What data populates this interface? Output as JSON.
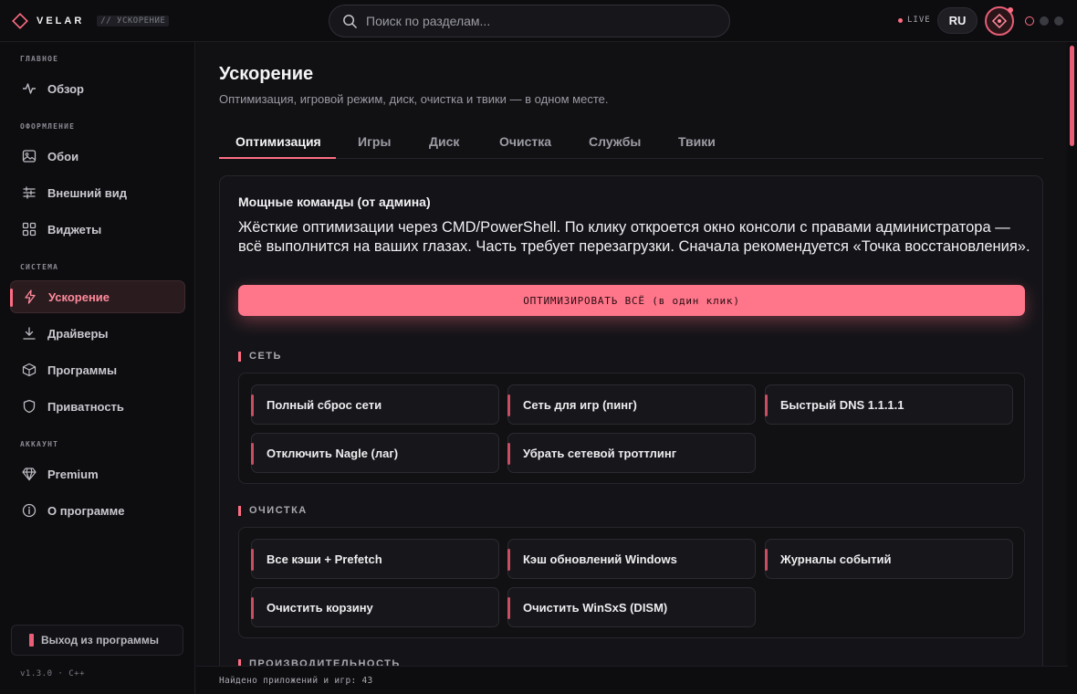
{
  "brand": {
    "name": "VELAR",
    "crumb": "// УСКОРЕНИЕ"
  },
  "search": {
    "placeholder": "Поиск по разделам..."
  },
  "header": {
    "live": "LIVE",
    "lang": "RU"
  },
  "colors": {
    "accent": "#ff6d84",
    "background": "#111114",
    "sidebar": "#0d0d10"
  },
  "sidebar": {
    "sections": [
      {
        "title": "ГЛАВНОЕ",
        "items": [
          {
            "label": "Обзор",
            "icon": "activity-icon"
          }
        ]
      },
      {
        "title": "ОФОРМЛЕНИЕ",
        "items": [
          {
            "label": "Обои",
            "icon": "image-icon"
          },
          {
            "label": "Внешний вид",
            "icon": "sliders-icon"
          },
          {
            "label": "Виджеты",
            "icon": "grid-icon"
          }
        ]
      },
      {
        "title": "СИСТЕМА",
        "items": [
          {
            "label": "Ускорение",
            "icon": "lightning-icon",
            "active": true
          },
          {
            "label": "Драйверы",
            "icon": "download-icon"
          },
          {
            "label": "Программы",
            "icon": "box-icon"
          },
          {
            "label": "Приватность",
            "icon": "shield-icon"
          }
        ]
      },
      {
        "title": "АККАУНТ",
        "items": [
          {
            "label": "Premium",
            "icon": "diamond-icon"
          },
          {
            "label": "О программе",
            "icon": "info-icon"
          }
        ]
      }
    ],
    "exit_label": "Выход из программы",
    "version": "v1.3.0 · C++"
  },
  "page": {
    "title": "Ускорение",
    "subtitle": "Оптимизация, игровой режим, диск, очистка и твики — в одном месте.",
    "tabs": [
      "Оптимизация",
      "Игры",
      "Диск",
      "Очистка",
      "Службы",
      "Твики"
    ],
    "active_tab": "Оптимизация"
  },
  "panel": {
    "title": "Мощные команды (от админа)",
    "description": "Жёсткие оптимизации через CMD/PowerShell. По клику откроется окно консоли с правами администратора — всё выполнится на ваших глазах. Часть требует перезагрузки. Сначала рекомендуется «Точка восстановления».",
    "optimize_all_label": "ОПТИМИЗИРОВАТЬ ВСЁ (в один клик)",
    "groups": [
      {
        "label": "СЕТЬ",
        "commands": [
          "Полный сброс сети",
          "Сеть для игр (пинг)",
          "Быстрый DNS 1.1.1.1",
          "Отключить Nagle (лаг)",
          "Убрать сетевой троттлинг"
        ]
      },
      {
        "label": "ОЧИСТКА",
        "commands": [
          "Все кэши + Prefetch",
          "Кэш обновлений Windows",
          "Журналы событий",
          "Очистить корзину",
          "Очистить WinSxS (DISM)"
        ]
      },
      {
        "label": "ПРОИЗВОДИТЕЛЬНОСТЬ"
      }
    ]
  },
  "status": {
    "text": "Найдено приложений и игр: 43"
  }
}
